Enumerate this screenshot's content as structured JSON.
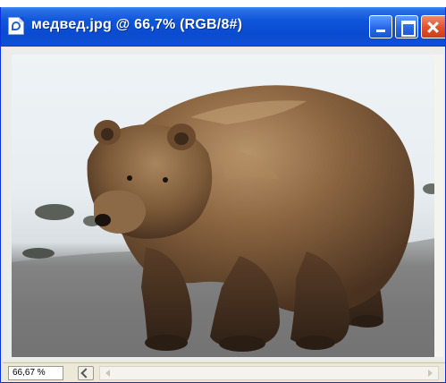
{
  "window": {
    "title": "медвед.jpg @ 66,7% (RGB/8#)",
    "icons": {
      "app": "photoshop-document-icon",
      "minimize": "minimize-icon",
      "maximize": "maximize-icon",
      "close": "close-icon"
    }
  },
  "document": {
    "image_subject": "bear-photo"
  },
  "statusbar": {
    "zoom": "66,67 %",
    "nav_icon": "navigator-icon"
  },
  "colors": {
    "titlebar": "#0a4bd0",
    "close_button": "#e0502a",
    "window_frame": "#ece9d8"
  }
}
